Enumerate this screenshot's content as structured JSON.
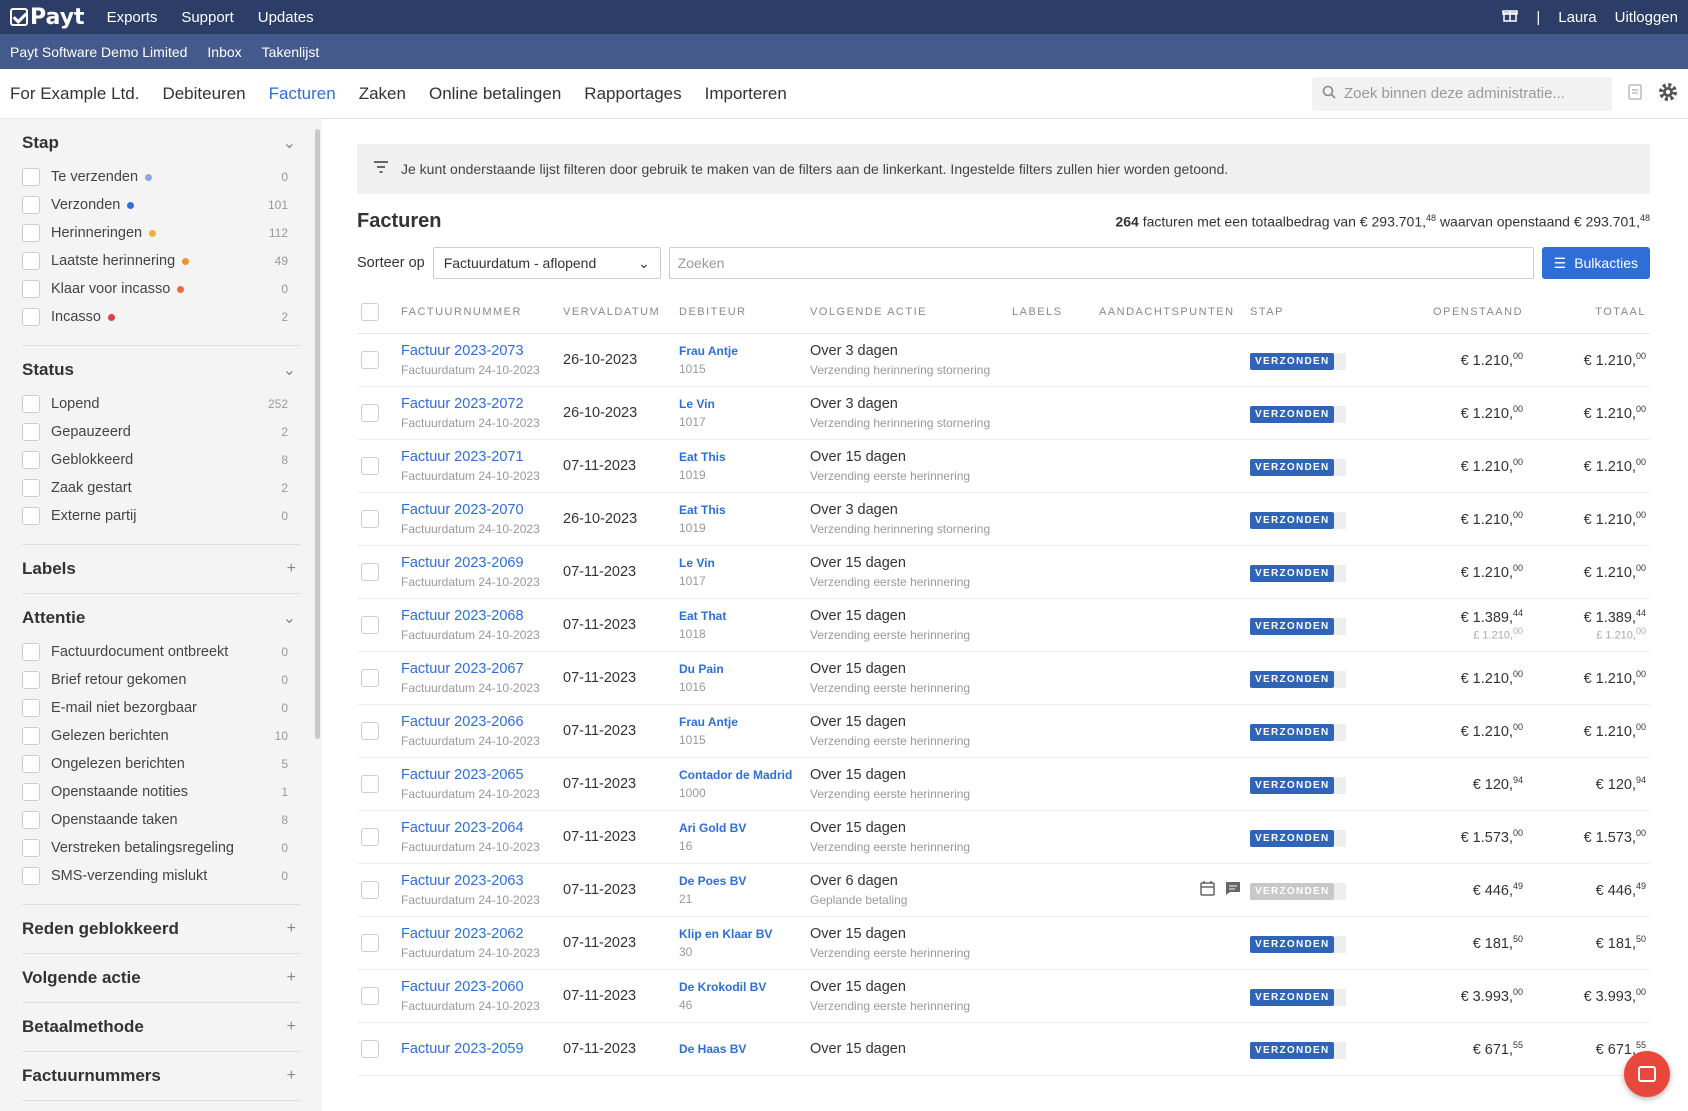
{
  "topbar": {
    "logo": "Payt",
    "nav": [
      "Exports",
      "Support",
      "Updates"
    ],
    "gift_icon": "gift-icon",
    "separator": "|",
    "user": "Laura",
    "logout": "Uitloggen"
  },
  "subbar": {
    "items": [
      "Payt Software Demo Limited",
      "Inbox",
      "Takenlijst"
    ]
  },
  "mainnav": {
    "company": "For Example Ltd.",
    "items": [
      "Debiteuren",
      "Facturen",
      "Zaken",
      "Online betalingen",
      "Rapportages",
      "Importeren"
    ],
    "active": "Facturen",
    "search_placeholder": "Zoek binnen deze administratie..."
  },
  "sidebar": {
    "stap": {
      "title": "Stap",
      "items": [
        {
          "label": "Te verzenden",
          "count": "0",
          "dot": "#8aa9e6"
        },
        {
          "label": "Verzonden",
          "count": "101",
          "dot": "#2d6fd6"
        },
        {
          "label": "Herinneringen",
          "count": "112",
          "dot": "#f2b134"
        },
        {
          "label": "Laatste herinnering",
          "count": "49",
          "dot": "#f2922e"
        },
        {
          "label": "Klaar voor incasso",
          "count": "0",
          "dot": "#ef6a3c"
        },
        {
          "label": "Incasso",
          "count": "2",
          "dot": "#e23b4a"
        }
      ]
    },
    "status": {
      "title": "Status",
      "items": [
        {
          "label": "Lopend",
          "count": "252"
        },
        {
          "label": "Gepauzeerd",
          "count": "2"
        },
        {
          "label": "Geblokkeerd",
          "count": "8"
        },
        {
          "label": "Zaak gestart",
          "count": "2"
        },
        {
          "label": "Externe partij",
          "count": "0"
        }
      ]
    },
    "labels": {
      "title": "Labels"
    },
    "attentie": {
      "title": "Attentie",
      "items": [
        {
          "label": "Factuurdocument ontbreekt",
          "count": "0"
        },
        {
          "label": "Brief retour gekomen",
          "count": "0"
        },
        {
          "label": "E-mail niet bezorgbaar",
          "count": "0"
        },
        {
          "label": "Gelezen berichten",
          "count": "10"
        },
        {
          "label": "Ongelezen berichten",
          "count": "5"
        },
        {
          "label": "Openstaande notities",
          "count": "1"
        },
        {
          "label": "Openstaande taken",
          "count": "8"
        },
        {
          "label": "Verstreken betalingsregeling",
          "count": "0"
        },
        {
          "label": "SMS-verzending mislukt",
          "count": "0"
        }
      ]
    },
    "reden": {
      "title": "Reden geblokkeerd"
    },
    "volgende": {
      "title": "Volgende actie"
    },
    "betaal": {
      "title": "Betaalmethode"
    },
    "factuurnummers": {
      "title": "Factuurnummers"
    }
  },
  "content": {
    "info": "Je kunt onderstaande lijst filteren door gebruik te maken van de filters aan de linkerkant. Ingestelde filters zullen hier worden getoond.",
    "title": "Facturen",
    "summary": {
      "count": "264",
      "text1": "facturen met een totaalbedrag van € 293.701,",
      "cents1": "48",
      "text2": "waarvan openstaand € 293.701,",
      "cents2": "48"
    },
    "sort_label": "Sorteer op",
    "sort_value": "Factuurdatum - aflopend",
    "search_placeholder": "Zoeken",
    "bulk_label": "Bulkacties",
    "columns": [
      "FACTUURNUMMER",
      "VERVALDATUM",
      "DEBITEUR",
      "VOLGENDE ACTIE",
      "LABELS",
      "AANDACHTSPUNTEN",
      "STAP",
      "OPENSTAAND",
      "TOTAAL"
    ],
    "rows": [
      {
        "inv": "Factuur 2023-2073",
        "date": "Factuurdatum 24-10-2023",
        "due": "26-10-2023",
        "deb": "Frau Antje",
        "debnr": "1015",
        "act": "Over 3 dagen",
        "actsub": "Verzending herinnering stornering",
        "stap": "VERZONDEN",
        "open": "€ 1.210,",
        "openc": "00",
        "tot": "€ 1.210,",
        "totc": "00"
      },
      {
        "inv": "Factuur 2023-2072",
        "date": "Factuurdatum 24-10-2023",
        "due": "26-10-2023",
        "deb": "Le Vin",
        "debnr": "1017",
        "act": "Over 3 dagen",
        "actsub": "Verzending herinnering stornering",
        "stap": "VERZONDEN",
        "open": "€ 1.210,",
        "openc": "00",
        "tot": "€ 1.210,",
        "totc": "00"
      },
      {
        "inv": "Factuur 2023-2071",
        "date": "Factuurdatum 24-10-2023",
        "due": "07-11-2023",
        "deb": "Eat This",
        "debnr": "1019",
        "act": "Over 15 dagen",
        "actsub": "Verzending eerste herinnering",
        "stap": "VERZONDEN",
        "open": "€ 1.210,",
        "openc": "00",
        "tot": "€ 1.210,",
        "totc": "00"
      },
      {
        "inv": "Factuur 2023-2070",
        "date": "Factuurdatum 24-10-2023",
        "due": "26-10-2023",
        "deb": "Eat This",
        "debnr": "1019",
        "act": "Over 3 dagen",
        "actsub": "Verzending herinnering stornering",
        "stap": "VERZONDEN",
        "open": "€ 1.210,",
        "openc": "00",
        "tot": "€ 1.210,",
        "totc": "00"
      },
      {
        "inv": "Factuur 2023-2069",
        "date": "Factuurdatum 24-10-2023",
        "due": "07-11-2023",
        "deb": "Le Vin",
        "debnr": "1017",
        "act": "Over 15 dagen",
        "actsub": "Verzending eerste herinnering",
        "stap": "VERZONDEN",
        "open": "€ 1.210,",
        "openc": "00",
        "tot": "€ 1.210,",
        "totc": "00"
      },
      {
        "inv": "Factuur 2023-2068",
        "date": "Factuurdatum 24-10-2023",
        "due": "07-11-2023",
        "deb": "Eat That",
        "debnr": "1018",
        "act": "Over 15 dagen",
        "actsub": "Verzending eerste herinnering",
        "stap": "VERZONDEN",
        "open": "€ 1.389,",
        "openc": "44",
        "opensub": "£ 1.210,",
        "opensubc": "00",
        "tot": "€ 1.389,",
        "totc": "44",
        "totsub": "£ 1.210,",
        "totsubc": "00"
      },
      {
        "inv": "Factuur 2023-2067",
        "date": "Factuurdatum 24-10-2023",
        "due": "07-11-2023",
        "deb": "Du Pain",
        "debnr": "1016",
        "act": "Over 15 dagen",
        "actsub": "Verzending eerste herinnering",
        "stap": "VERZONDEN",
        "open": "€ 1.210,",
        "openc": "00",
        "tot": "€ 1.210,",
        "totc": "00"
      },
      {
        "inv": "Factuur 2023-2066",
        "date": "Factuurdatum 24-10-2023",
        "due": "07-11-2023",
        "deb": "Frau Antje",
        "debnr": "1015",
        "act": "Over 15 dagen",
        "actsub": "Verzending eerste herinnering",
        "stap": "VERZONDEN",
        "open": "€ 1.210,",
        "openc": "00",
        "tot": "€ 1.210,",
        "totc": "00"
      },
      {
        "inv": "Factuur 2023-2065",
        "date": "Factuurdatum 24-10-2023",
        "due": "07-11-2023",
        "deb": "Contador de Madrid",
        "debnr": "1000",
        "act": "Over 15 dagen",
        "actsub": "Verzending eerste herinnering",
        "stap": "VERZONDEN",
        "open": "€ 120,",
        "openc": "94",
        "tot": "€ 120,",
        "totc": "94"
      },
      {
        "inv": "Factuur 2023-2064",
        "date": "Factuurdatum 24-10-2023",
        "due": "07-11-2023",
        "deb": "Ari Gold BV",
        "debnr": "16",
        "act": "Over 15 dagen",
        "actsub": "Verzending eerste herinnering",
        "stap": "VERZONDEN",
        "open": "€ 1.573,",
        "openc": "00",
        "tot": "€ 1.573,",
        "totc": "00"
      },
      {
        "inv": "Factuur 2023-2063",
        "date": "Factuurdatum 24-10-2023",
        "due": "07-11-2023",
        "deb": "De Poes BV",
        "debnr": "21",
        "act": "Over 6 dagen",
        "actsub": "Geplande betaling",
        "stap": "VERZONDEN",
        "grey": true,
        "icons": true,
        "open": "€ 446,",
        "openc": "49",
        "tot": "€ 446,",
        "totc": "49"
      },
      {
        "inv": "Factuur 2023-2062",
        "date": "Factuurdatum 24-10-2023",
        "due": "07-11-2023",
        "deb": "Klip en Klaar BV",
        "debnr": "30",
        "act": "Over 15 dagen",
        "actsub": "Verzending eerste herinnering",
        "stap": "VERZONDEN",
        "open": "€ 181,",
        "openc": "50",
        "tot": "€ 181,",
        "totc": "50"
      },
      {
        "inv": "Factuur 2023-2060",
        "date": "Factuurdatum 24-10-2023",
        "due": "07-11-2023",
        "deb": "De Krokodil BV",
        "debnr": "46",
        "act": "Over 15 dagen",
        "actsub": "Verzending eerste herinnering",
        "stap": "VERZONDEN",
        "open": "€ 3.993,",
        "openc": "00",
        "tot": "€ 3.993,",
        "totc": "00"
      },
      {
        "inv": "Factuur 2023-2059",
        "date": "",
        "due": "07-11-2023",
        "deb": "De Haas BV",
        "debnr": "",
        "act": "Over 15 dagen",
        "actsub": "",
        "stap": "VERZONDEN",
        "open": "€ 671,",
        "openc": "55",
        "tot": "€ 671,",
        "totc": "55"
      }
    ]
  }
}
